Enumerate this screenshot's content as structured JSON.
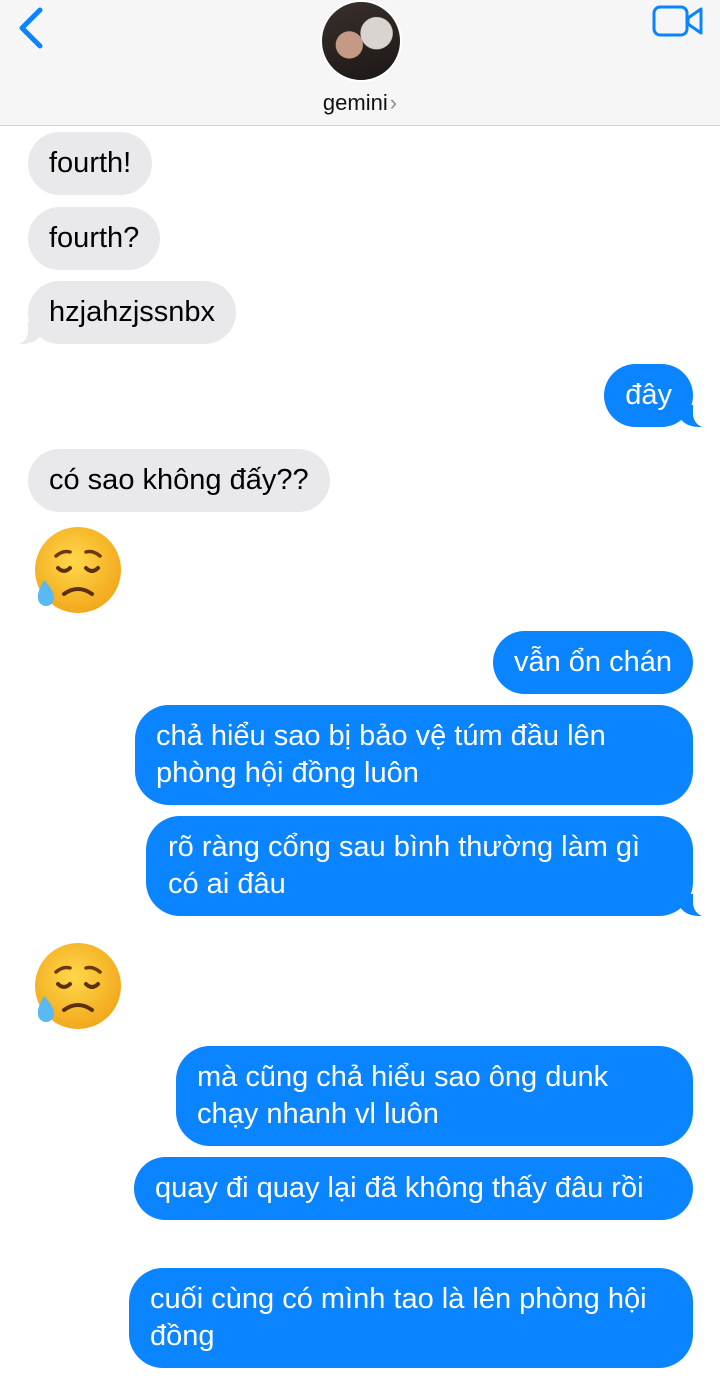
{
  "header": {
    "contact_name": "gemini",
    "chevron": "›",
    "icons": {
      "back": "chevron-left-icon",
      "video": "video-camera-icon"
    },
    "accent": "#0a84ff"
  },
  "messages": [
    {
      "from": "them",
      "text": "fourth!"
    },
    {
      "from": "them",
      "text": "fourth?"
    },
    {
      "from": "them",
      "text": "hzjahzjssnbx"
    },
    {
      "from": "me",
      "text": "đây"
    },
    {
      "from": "them",
      "text": "có sao không đấy??"
    },
    {
      "from": "them",
      "emoji": "sad-sweat-face"
    },
    {
      "from": "me",
      "text": "vẫn ổn chán"
    },
    {
      "from": "me",
      "text": "chả hiểu sao bị bảo vệ túm đầu lên phòng hội đồng luôn"
    },
    {
      "from": "me",
      "text": "rõ ràng cổng sau bình thường làm gì có ai đâu"
    },
    {
      "from": "them",
      "emoji": "sad-sweat-face"
    },
    {
      "from": "me",
      "text": "mà cũng chả hiểu sao ông dunk chạy nhanh vl luôn"
    },
    {
      "from": "me",
      "text": "quay đi quay lại đã không thấy đâu rồi"
    },
    {
      "from": "me",
      "text": "cuối cùng có mình tao là lên phòng hội đồng"
    }
  ],
  "colors": {
    "incoming_bubble": "#e9e9eb",
    "outgoing_bubble": "#0a84ff"
  }
}
